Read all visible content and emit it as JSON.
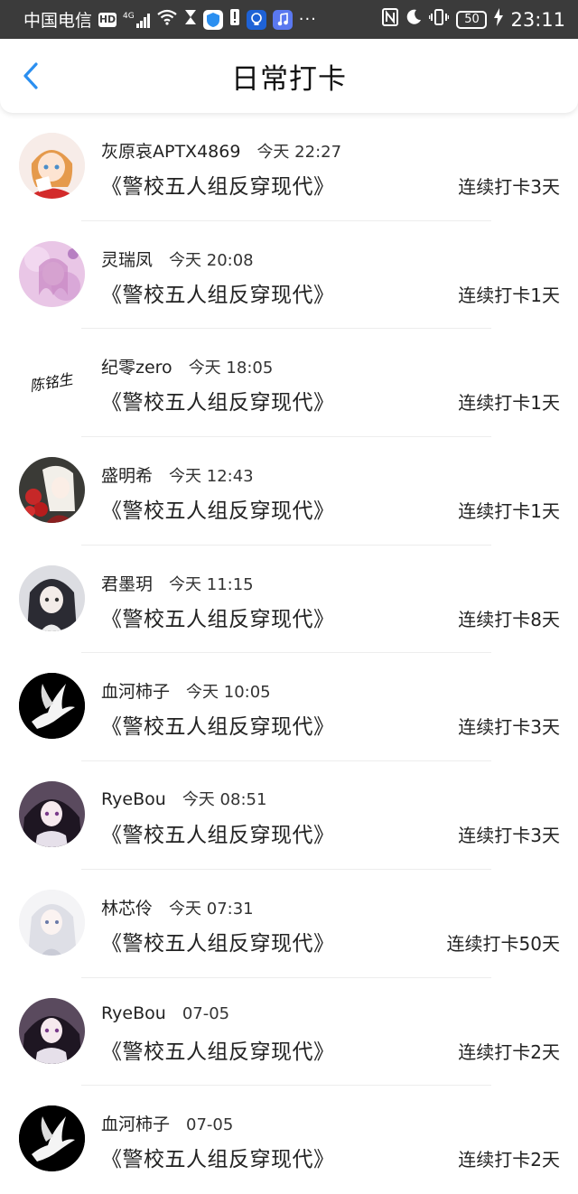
{
  "status_bar": {
    "carrier": "中国电信",
    "hd": "HD",
    "network": "4G",
    "battery": "50",
    "time": "23:11",
    "icons": [
      "signal-icon",
      "wifi-icon",
      "hourglass-icon",
      "shield-app-icon",
      "alert-icon",
      "bulb-app-icon",
      "music-app-icon",
      "more-icon",
      "nfc-icon",
      "moon-icon",
      "vibrate-icon",
      "battery-icon",
      "charging-icon"
    ]
  },
  "header": {
    "title": "日常打卡",
    "back_icon": "chevron-left-icon",
    "accent": "#2b8ff0"
  },
  "entries": [
    {
      "name": "灰原哀APTX4869",
      "time": "今天 22:27",
      "book": "《警校五人组反穿现代》",
      "streak": "连续打卡3天",
      "avatar": "anime-girl-red-avatar"
    },
    {
      "name": "灵瑞凤",
      "time": "今天 20:08",
      "book": "《警校五人组反穿现代》",
      "streak": "连续打卡1天",
      "avatar": "pink-anime-avatar"
    },
    {
      "name": "纪零zero",
      "time": "今天 18:05",
      "book": "《警校五人组反穿现代》",
      "streak": "连续打卡1天",
      "avatar": "calligraphy-avatar",
      "avatar_text": "陈铭生"
    },
    {
      "name": "盛明希",
      "time": "今天 12:43",
      "book": "《警校五人组反穿现代》",
      "streak": "连续打卡1天",
      "avatar": "anime-girl-roses-avatar"
    },
    {
      "name": "君墨玥",
      "time": "今天 11:15",
      "book": "《警校五人组反穿现代》",
      "streak": "连续打卡8天",
      "avatar": "anime-girl-dark-hair-avatar"
    },
    {
      "name": "血河柿子",
      "time": "今天 10:05",
      "book": "《警校五人组反穿现代》",
      "streak": "连续打卡3天",
      "avatar": "white-dove-avatar"
    },
    {
      "name": "RyeBou",
      "time": "今天 08:51",
      "book": "《警校五人组反穿现代》",
      "streak": "连续打卡3天",
      "avatar": "dark-anime-girl-avatar"
    },
    {
      "name": "林芯伶",
      "time": "今天 07:31",
      "book": "《警校五人组反穿现代》",
      "streak": "连续打卡50天",
      "avatar": "white-hair-girl-avatar"
    },
    {
      "name": "RyeBou",
      "time": "07-05",
      "book": "《警校五人组反穿现代》",
      "streak": "连续打卡2天",
      "avatar": "dark-anime-girl-avatar"
    },
    {
      "name": "血河柿子",
      "time": "07-05",
      "book": "《警校五人组反穿现代》",
      "streak": "连续打卡2天",
      "avatar": "white-dove-avatar"
    }
  ]
}
